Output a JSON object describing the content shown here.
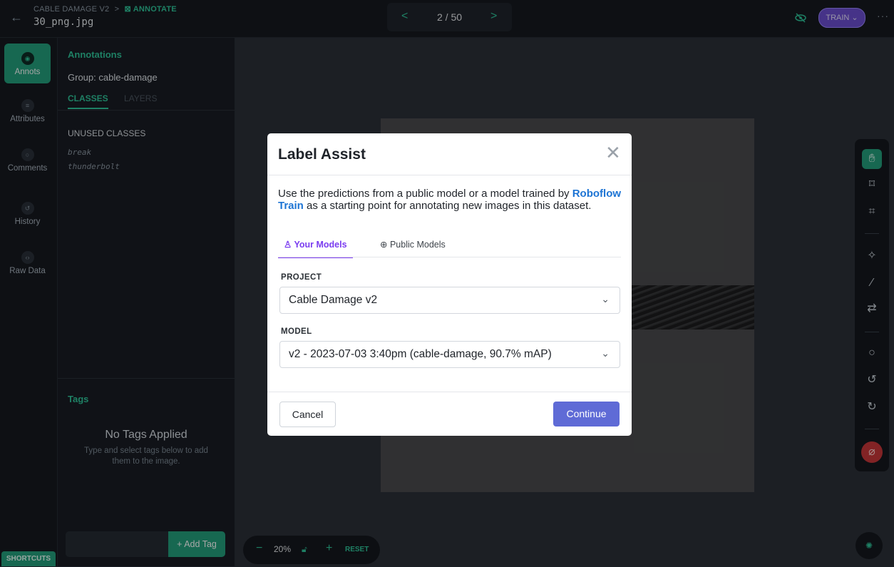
{
  "topbar": {
    "crumb_project": "CABLE DAMAGE V2",
    "crumb_sep": ">",
    "crumb_page": "ANNOTATE",
    "filename": "30_png.jpg",
    "pager": {
      "prev": "<",
      "count": "2 / 50",
      "next": ">"
    },
    "train_label": "TRAIN ⌄",
    "more": "···"
  },
  "rail": {
    "items": [
      {
        "label": "Annots",
        "icon": "annotations-icon"
      },
      {
        "label": "Attributes",
        "icon": "list-icon"
      },
      {
        "label": "Comments",
        "icon": "comment-icon"
      },
      {
        "label": "History",
        "icon": "history-icon"
      },
      {
        "label": "Raw Data",
        "icon": "code-icon"
      }
    ],
    "shortcuts": "SHORTCUTS"
  },
  "panel": {
    "title": "Annotations",
    "group_label": "Group: cable-damage",
    "tabs": {
      "classes": "CLASSES",
      "layers": "LAYERS"
    },
    "unused_heading": "UNUSED CLASSES",
    "classes": [
      "break",
      "thunderbolt"
    ],
    "tags_title": "Tags",
    "no_tags": "No Tags Applied",
    "no_tags_sub": "Type and select tags below to add them to the image.",
    "add_tag": "+ Add Tag"
  },
  "zoom": {
    "minus": "−",
    "percent": "20%",
    "plus": "+",
    "reset": "RESET"
  },
  "modal": {
    "title": "Label Assist",
    "close": "✕",
    "desc_before": "Use the predictions from a public model or a model trained by ",
    "desc_link": "Roboflow Train",
    "desc_after": " as a starting point for annotating new images in this dataset.",
    "tab_your": "Your Models",
    "tab_public": "Public Models",
    "project_label": "PROJECT",
    "project_value": "Cable Damage v2",
    "model_label": "MODEL",
    "model_value": "v2 - 2023-07-03 3:40pm (cable-damage, 90.7% mAP)",
    "cancel": "Cancel",
    "continue": "Continue"
  },
  "colors": {
    "accent": "#2fc59a",
    "modal_tab": "#7a3cf0",
    "continue_button": "#5f6bd6",
    "link": "#1d74d4"
  }
}
